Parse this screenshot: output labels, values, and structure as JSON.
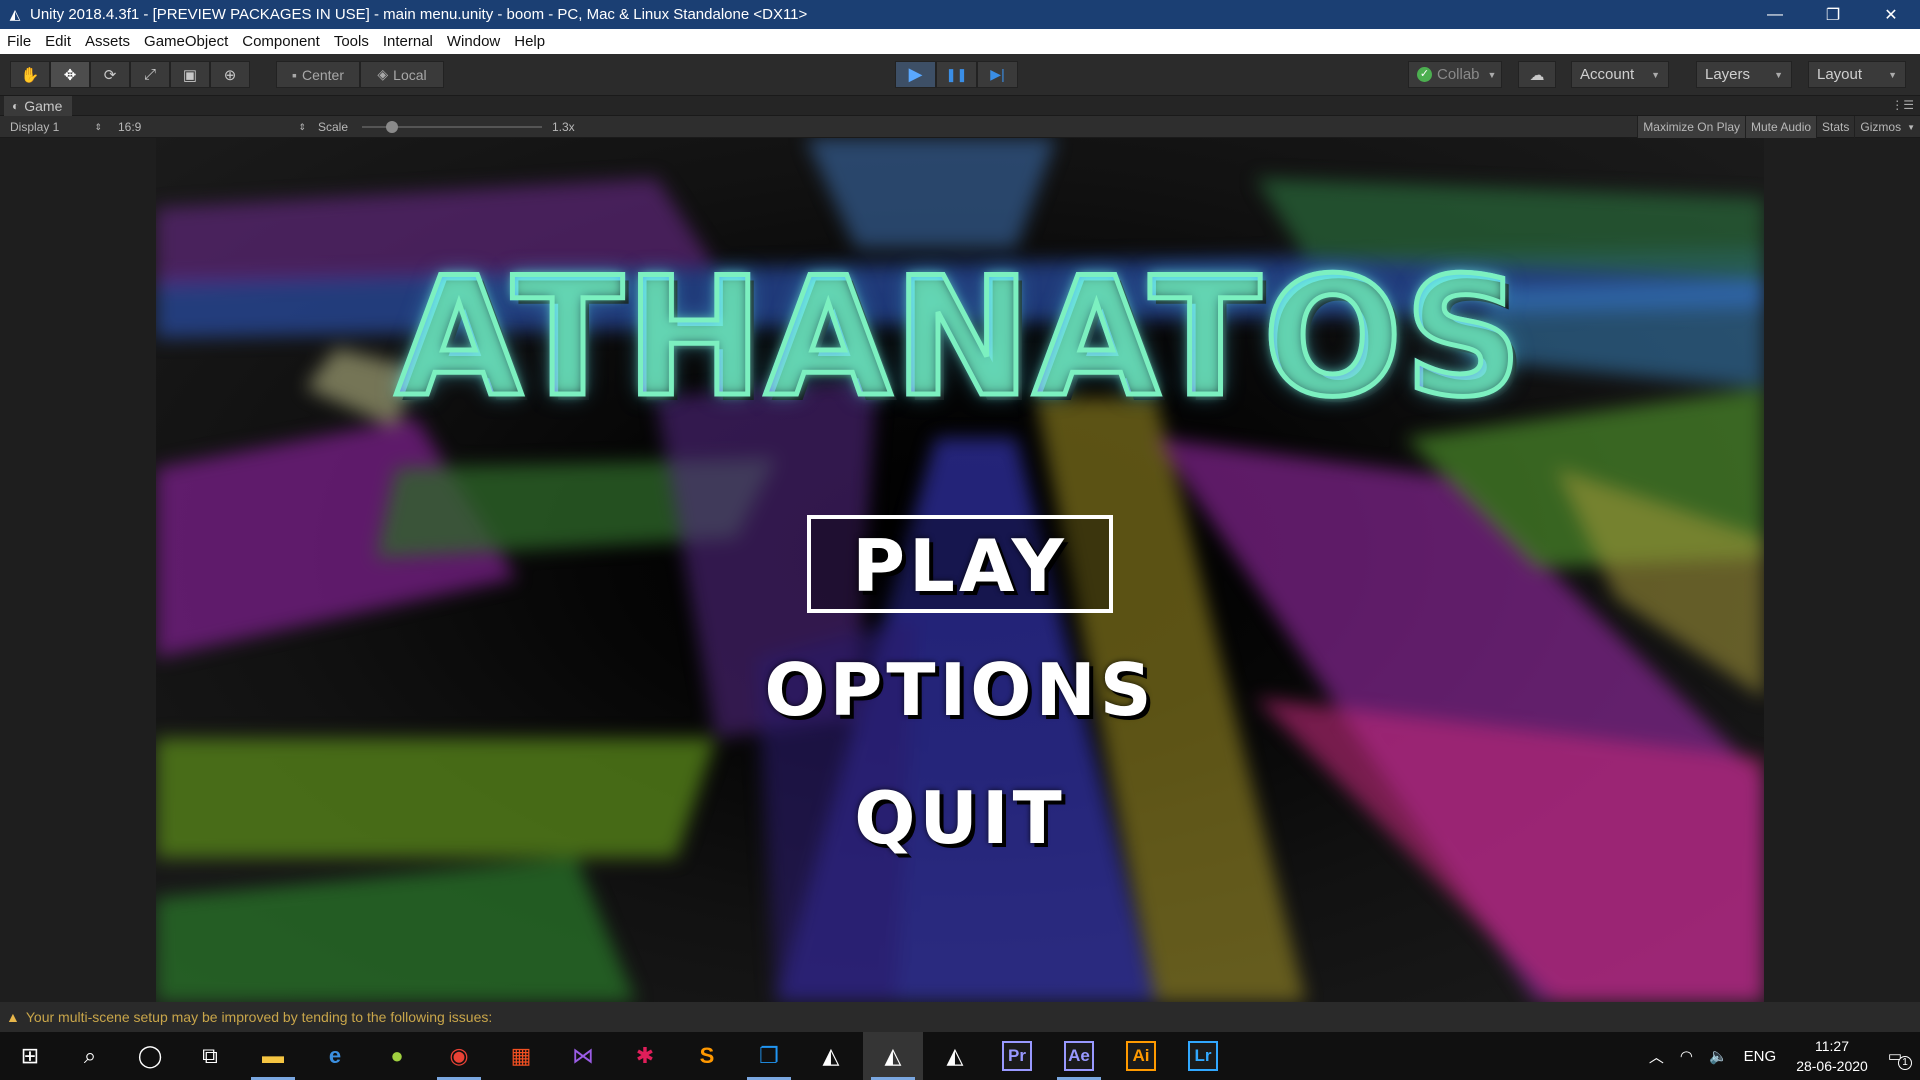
{
  "window": {
    "title": "Unity 2018.4.3f1 - [PREVIEW PACKAGES IN USE] - main menu.unity - boom - PC, Mac & Linux Standalone <DX11>",
    "minimize": "—",
    "restore": "❐",
    "close": "✕"
  },
  "menubar": [
    "File",
    "Edit",
    "Assets",
    "GameObject",
    "Component",
    "Tools",
    "Internal",
    "Window",
    "Help"
  ],
  "toolbar": {
    "tools": [
      "hand-tool",
      "move-tool",
      "rotate-tool",
      "scale-tool",
      "rect-tool",
      "transform-tool"
    ],
    "pivot_center": "Center",
    "pivot_local": "Local",
    "play": "▶",
    "pause": "❚❚",
    "step": "▶|",
    "collab": "Collab",
    "account": "Account",
    "layers": "Layers",
    "layout": "Layout"
  },
  "game_tab": {
    "label": "Game",
    "display": "Display 1",
    "aspect": "16:9",
    "scale_label": "Scale",
    "scale_value": "1.3x",
    "maximize_on_play": "Maximize On Play",
    "mute_audio": "Mute Audio",
    "stats": "Stats",
    "gizmos": "Gizmos"
  },
  "game": {
    "logo": "ATHANATOS",
    "play": "PLAY",
    "options": "OPTIONS",
    "quit": "QUIT"
  },
  "status": {
    "message": "Your multi-scene setup may be improved by tending to the following issues:"
  },
  "taskbar": {
    "apps": [
      "Premiere Pro",
      "After Effects",
      "Illustrator",
      "Lightroom"
    ],
    "app_labels": [
      "Pr",
      "Ae",
      "Ai",
      "Lr"
    ],
    "language": "ENG",
    "time": "11:27",
    "date": "28-06-2020",
    "notification_count": "1"
  },
  "colors": {
    "titlebar": "#1b3f73",
    "play_accent": "#3a8ee6",
    "logo_stroke": "#7cf0c0",
    "premiere": "#9999ff",
    "after_effects": "#9999ff",
    "illustrator": "#ff9a00",
    "lightroom": "#31a8ff"
  }
}
